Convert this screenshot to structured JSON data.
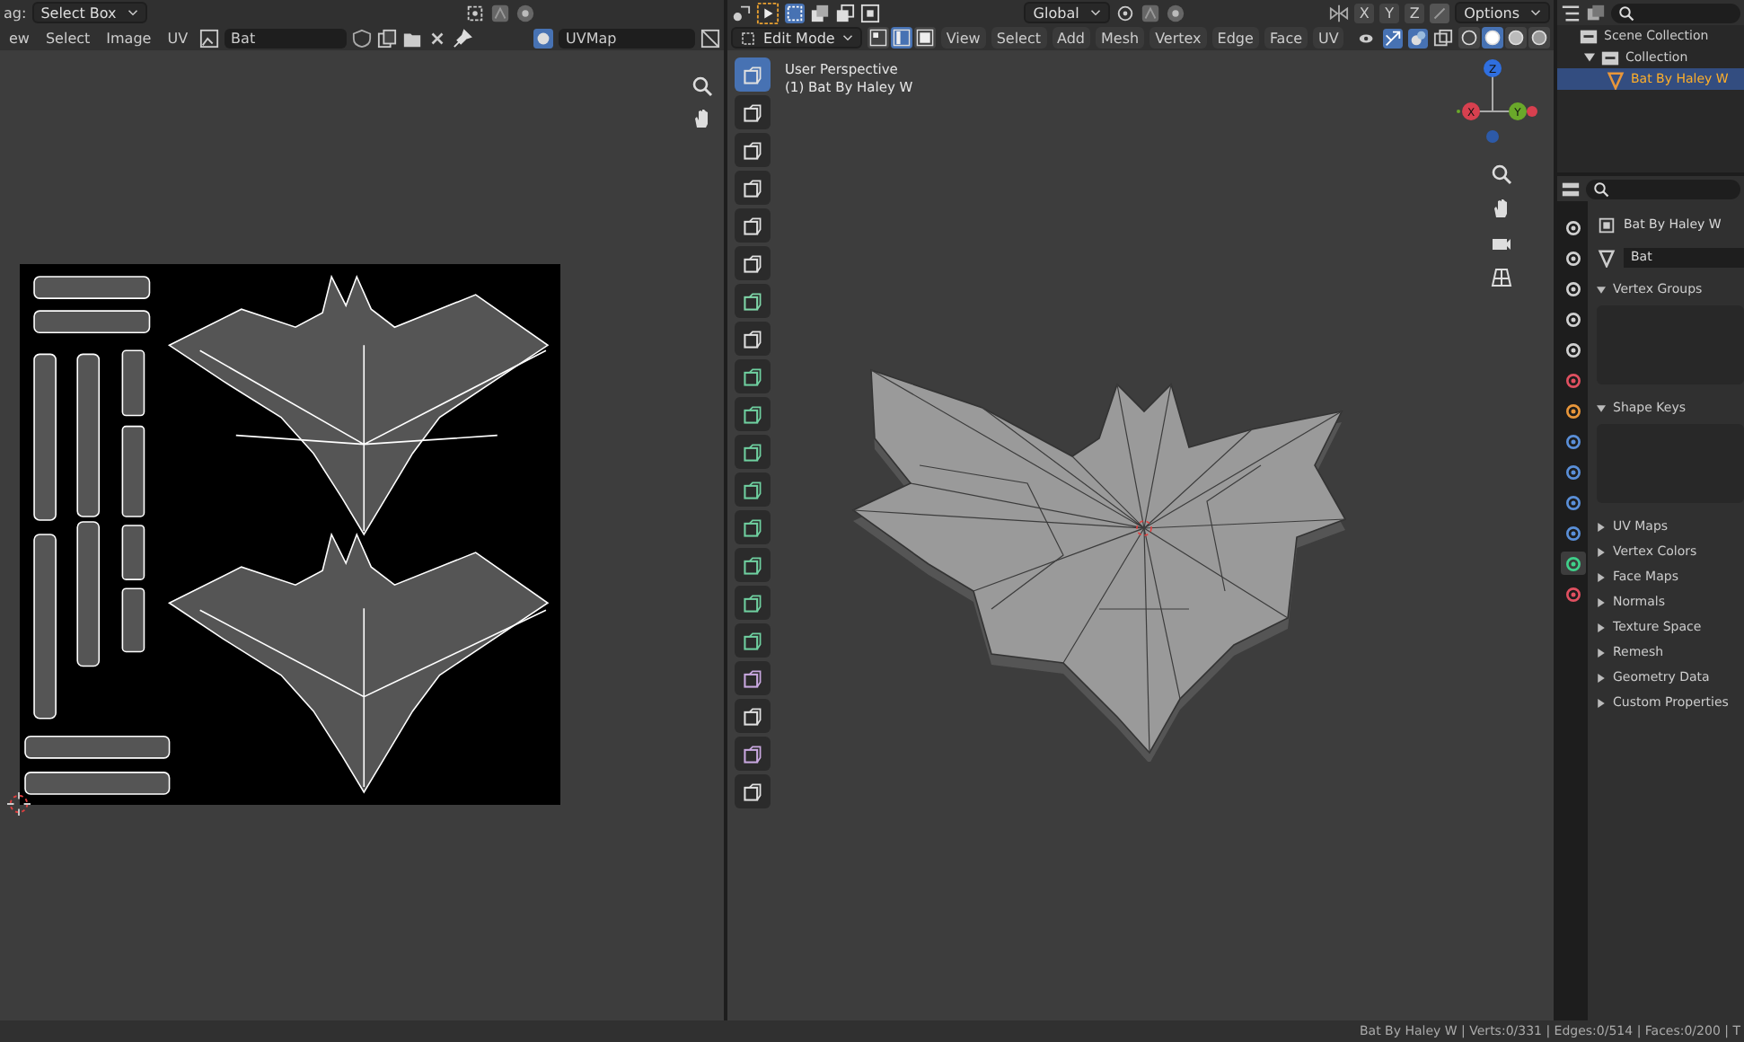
{
  "uv_editor": {
    "tool_label": "ag:",
    "tool": "Select Box",
    "menus": [
      "ew",
      "Select",
      "Image",
      "UV"
    ],
    "image": "Bat",
    "uv_map": "UVMap"
  },
  "viewport": {
    "orientation": "Global",
    "axes": [
      "X",
      "Y",
      "Z"
    ],
    "options": "Options",
    "mode": "Edit Mode",
    "select_modes": [
      {
        "kind": "vertex",
        "selected": false
      },
      {
        "kind": "edge",
        "selected": true
      },
      {
        "kind": "face",
        "selected": false
      }
    ],
    "menus": [
      "View",
      "Select",
      "Add",
      "Mesh",
      "Vertex",
      "Edge",
      "Face",
      "UV"
    ],
    "shading": [
      {
        "kind": "wireframe",
        "selected": false
      },
      {
        "kind": "solid",
        "selected": true
      },
      {
        "kind": "material",
        "selected": false
      },
      {
        "kind": "rendered",
        "selected": false
      }
    ],
    "view_name": "User Perspective",
    "object_name": "(1) Bat By Haley W",
    "gizmo": [
      "Z",
      "X",
      "Y"
    ],
    "tools": [
      {
        "kind": "select",
        "selected": true
      },
      {
        "kind": "cursor",
        "selected": false
      },
      {
        "kind": "move",
        "selected": false
      },
      {
        "kind": "rotate",
        "selected": false
      },
      {
        "kind": "scale",
        "selected": false
      },
      {
        "kind": "transform",
        "selected": false
      },
      {
        "kind": "annotate",
        "selected": false
      },
      {
        "kind": "measure",
        "selected": false
      },
      {
        "kind": "mesh",
        "selected": false
      },
      {
        "kind": "mesh",
        "selected": false
      },
      {
        "kind": "mesh",
        "selected": false
      },
      {
        "kind": "mesh",
        "selected": false
      },
      {
        "kind": "mesh",
        "selected": false
      },
      {
        "kind": "mesh",
        "selected": false
      },
      {
        "kind": "mesh",
        "selected": false
      },
      {
        "kind": "mesh",
        "selected": false
      },
      {
        "kind": "sculpt",
        "selected": false
      },
      {
        "kind": "plain",
        "selected": false
      },
      {
        "kind": "sculpt",
        "selected": false
      },
      {
        "kind": "plain",
        "selected": false
      }
    ]
  },
  "outliner": {
    "root": "Scene Collection",
    "collection": "Collection",
    "collection_expanded": true,
    "object": "Bat By Haley W",
    "object_selected": true
  },
  "properties": {
    "object": "Bat By Haley W",
    "mesh": "Bat",
    "tabs": [
      {
        "kind": "tool",
        "selected": false
      },
      {
        "kind": "render",
        "selected": false
      },
      {
        "kind": "output",
        "selected": false
      },
      {
        "kind": "view",
        "selected": false
      },
      {
        "kind": "scene",
        "selected": false
      },
      {
        "kind": "world",
        "selected": false
      },
      {
        "kind": "object",
        "selected": false
      },
      {
        "kind": "modifier",
        "selected": false
      },
      {
        "kind": "particles",
        "selected": false
      },
      {
        "kind": "physics",
        "selected": false
      },
      {
        "kind": "constraints",
        "selected": false
      },
      {
        "kind": "data",
        "selected": true
      },
      {
        "kind": "material",
        "selected": false
      }
    ],
    "panels": [
      {
        "label": "Vertex Groups",
        "expanded": true
      },
      {
        "label": "Shape Keys",
        "expanded": true
      },
      {
        "label": "UV Maps",
        "expanded": false
      },
      {
        "label": "Vertex Colors",
        "expanded": false
      },
      {
        "label": "Face Maps",
        "expanded": false
      },
      {
        "label": "Normals",
        "expanded": false
      },
      {
        "label": "Texture Space",
        "expanded": false
      },
      {
        "label": "Remesh",
        "expanded": false
      },
      {
        "label": "Geometry Data",
        "expanded": false
      },
      {
        "label": "Custom Properties",
        "expanded": false
      }
    ]
  },
  "status_bar": {
    "stats": "Bat By Haley W | Verts:0/331 | Edges:0/514 | Faces:0/200 | T"
  }
}
